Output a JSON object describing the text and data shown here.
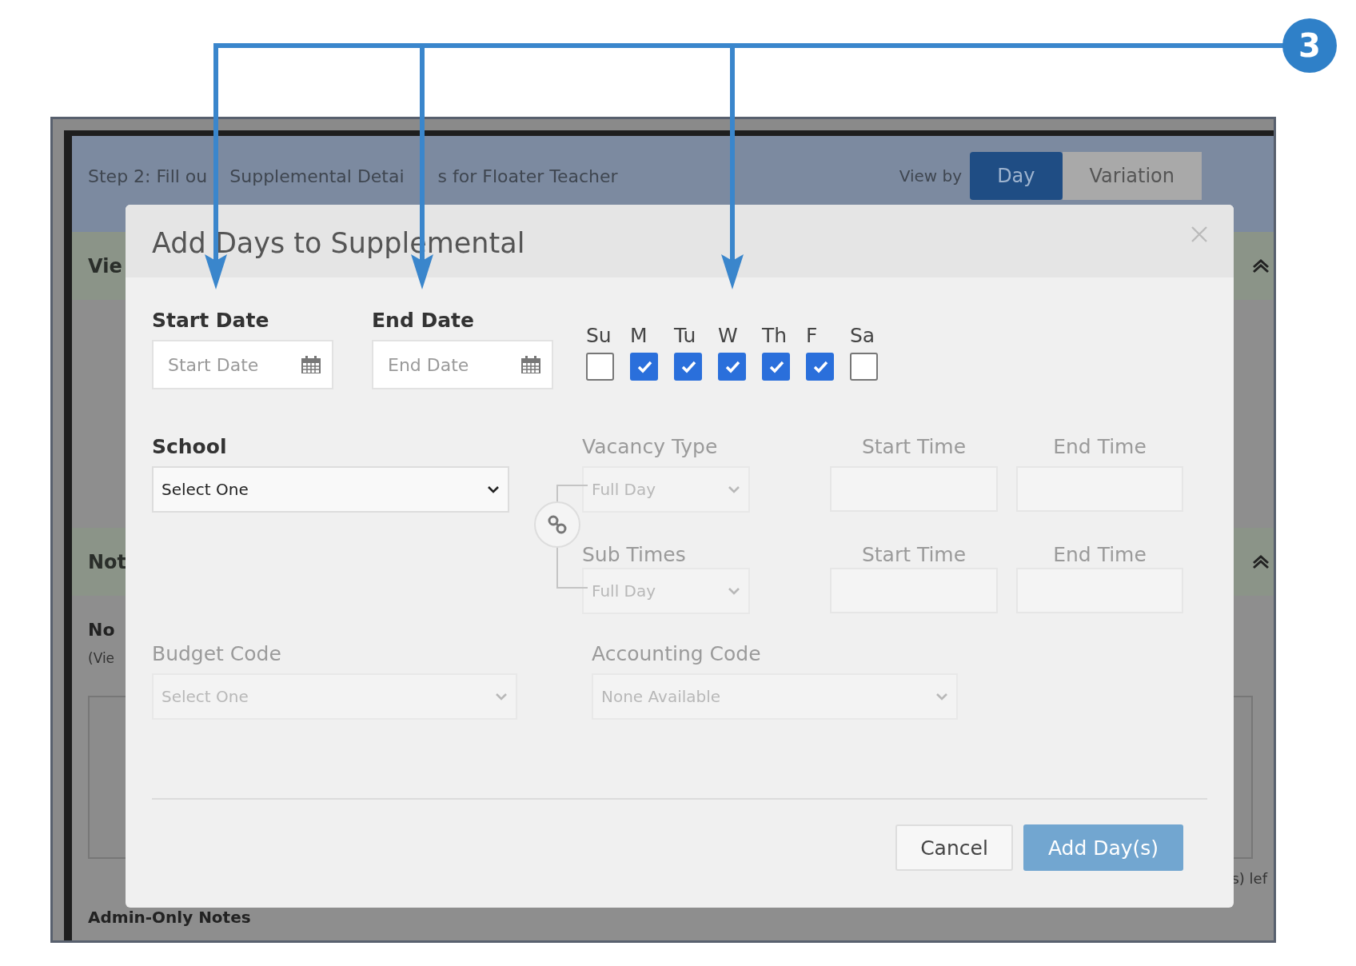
{
  "callout": {
    "number": "3"
  },
  "page": {
    "step_title_parts": [
      "Step 2: Fill ou",
      "Supplemental Detai",
      "s for Floater Teacher"
    ],
    "view_by_label": "View by",
    "view_tabs": [
      {
        "label": "Day",
        "selected": true
      },
      {
        "label": "Variation",
        "selected": false
      }
    ],
    "sections": [
      {
        "title": "Vie"
      },
      {
        "title": "Not"
      }
    ],
    "notes_heading": "No",
    "notes_hint": "(Vie",
    "counter_fragment": "s) lef",
    "admin_notes_heading": "Admin-Only Notes"
  },
  "modal": {
    "title": "Add Days to Supplemental",
    "start_date": {
      "label": "Start Date",
      "placeholder": "Start Date"
    },
    "end_date": {
      "label": "End Date",
      "placeholder": "End Date"
    },
    "weekdays": [
      {
        "label": "Su",
        "checked": false
      },
      {
        "label": "M",
        "checked": true
      },
      {
        "label": "Tu",
        "checked": true
      },
      {
        "label": "W",
        "checked": true
      },
      {
        "label": "Th",
        "checked": true
      },
      {
        "label": "F",
        "checked": true
      },
      {
        "label": "Sa",
        "checked": false
      }
    ],
    "school": {
      "label": "School",
      "value": "Select One",
      "disabled": false
    },
    "vacancy_type": {
      "label": "Vacancy Type",
      "value": "Full Day",
      "disabled": true
    },
    "vacancy_times": [
      {
        "label": "Start Time",
        "disabled": true
      },
      {
        "label": "End Time",
        "disabled": true
      }
    ],
    "sub_times": {
      "label": "Sub Times",
      "value": "Full Day",
      "disabled": true
    },
    "sub_time_fields": [
      {
        "label": "Start Time",
        "disabled": true
      },
      {
        "label": "End Time",
        "disabled": true
      }
    ],
    "budget_code": {
      "label": "Budget Code",
      "value": "Select One",
      "disabled": true
    },
    "accounting_code": {
      "label": "Accounting Code",
      "value": "None Available",
      "disabled": true
    },
    "buttons": [
      {
        "label": "Cancel",
        "kind": "secondary"
      },
      {
        "label": "Add Day(s)",
        "kind": "primary"
      }
    ]
  }
}
